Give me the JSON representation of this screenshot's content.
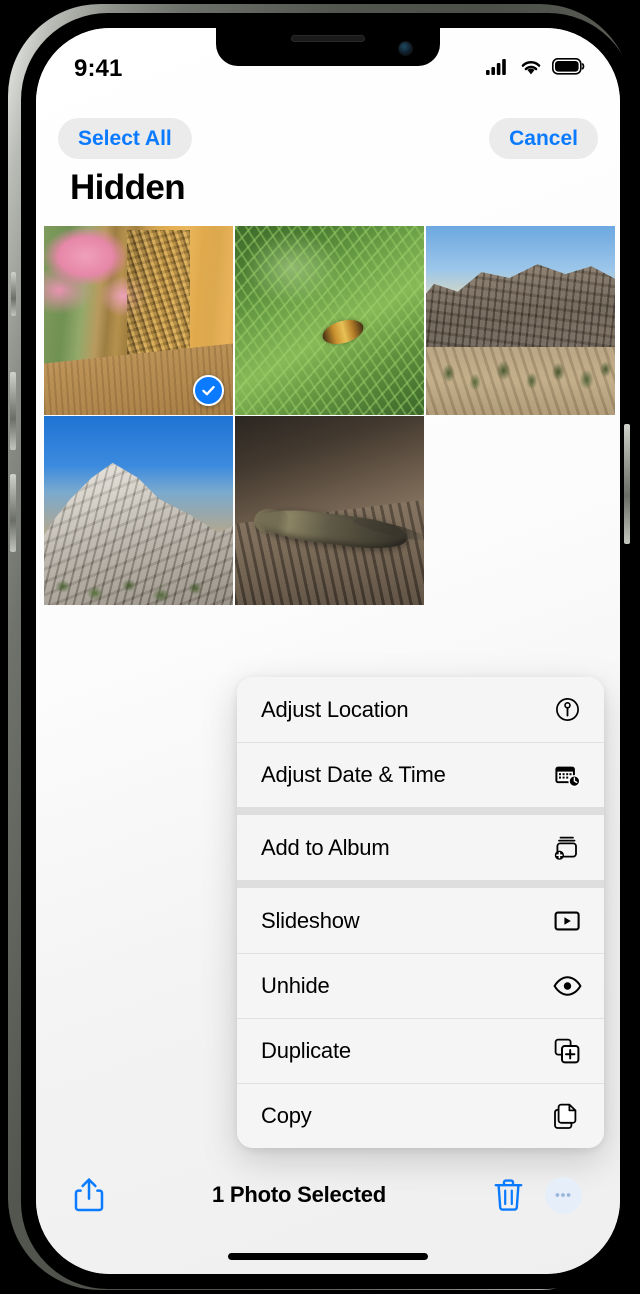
{
  "status_bar": {
    "time": "9:41",
    "icons": [
      "cellular-signal-icon",
      "wifi-icon",
      "battery-icon"
    ]
  },
  "nav": {
    "select_all_label": "Select All",
    "cancel_label": "Cancel"
  },
  "header": {
    "title": "Hidden"
  },
  "photo_grid": {
    "columns": 3,
    "selected_count": 1,
    "photos": [
      {
        "id": "photo-1",
        "art": "art-bees",
        "description": "Bee swarm on wooden post with pink flowers",
        "selected": true
      },
      {
        "id": "photo-2",
        "art": "art-fern",
        "description": "Bee on green fern foliage",
        "selected": false
      },
      {
        "id": "photo-3",
        "art": "art-rocks",
        "description": "Desert rock formation with Joshua trees",
        "selected": false
      },
      {
        "id": "photo-4",
        "art": "art-granite",
        "description": "Granite boulder under blue sky",
        "selected": false
      },
      {
        "id": "photo-5",
        "art": "art-lizard",
        "description": "Lizard resting on a rock",
        "selected": false
      }
    ]
  },
  "context_menu": {
    "groups": [
      {
        "items": [
          {
            "label": "Adjust Location",
            "icon": "location-pin-circle-icon"
          },
          {
            "label": "Adjust Date & Time",
            "icon": "calendar-clock-icon"
          }
        ]
      },
      {
        "items": [
          {
            "label": "Add to Album",
            "icon": "album-add-icon"
          }
        ]
      },
      {
        "items": [
          {
            "label": "Slideshow",
            "icon": "play-rectangle-icon"
          },
          {
            "label": "Unhide",
            "icon": "eye-icon"
          },
          {
            "label": "Duplicate",
            "icon": "duplicate-plus-icon"
          },
          {
            "label": "Copy",
            "icon": "copy-pages-icon"
          }
        ]
      }
    ]
  },
  "toolbar": {
    "share_icon": "share-icon",
    "status_text": "1 Photo Selected",
    "delete_icon": "trash-icon",
    "more_icon": "more-ellipsis-icon"
  },
  "colors": {
    "accent_blue": "#0a7aff",
    "menu_background": "#f5f5f5",
    "menu_divider": "#e0e0e0",
    "group_divider": "#dedede",
    "pill_background": "#ebebeb"
  }
}
